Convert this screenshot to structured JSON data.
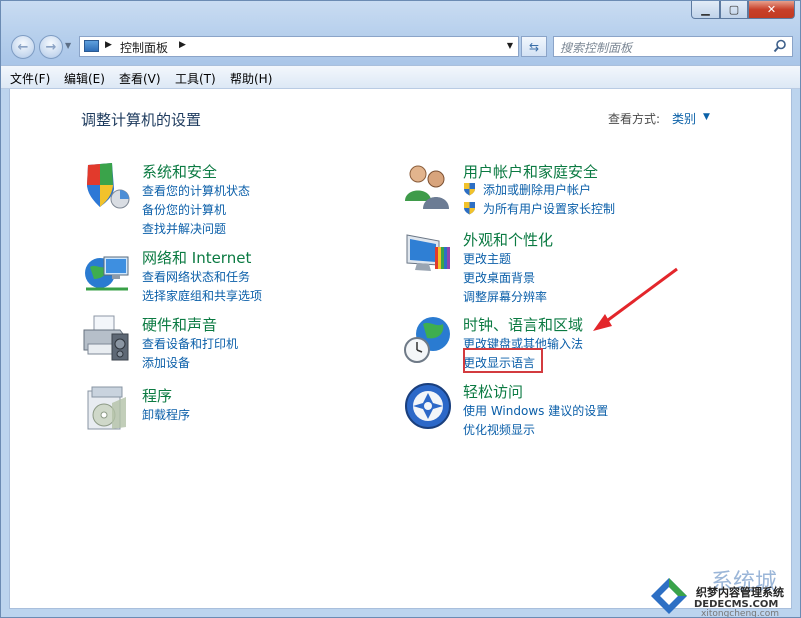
{
  "window": {
    "address": {
      "text": "控制面板"
    },
    "search": {
      "placeholder": "搜索控制面板"
    }
  },
  "menubar": {
    "items": [
      {
        "label": "文件(F)"
      },
      {
        "label": "编辑(E)"
      },
      {
        "label": "查看(V)"
      },
      {
        "label": "工具(T)"
      },
      {
        "label": "帮助(H)"
      }
    ]
  },
  "main": {
    "title": "调整计算机的设置",
    "view_label": "查看方式:",
    "view_value": "类别",
    "categories": [
      {
        "title": "系统和安全",
        "icon": "shield-icon",
        "links": [
          "查看您的计算机状态",
          "备份您的计算机",
          "查找并解决问题"
        ]
      },
      {
        "title": "网络和 Internet",
        "icon": "network-icon",
        "links": [
          "查看网络状态和任务",
          "选择家庭组和共享选项"
        ]
      },
      {
        "title": "硬件和声音",
        "icon": "printer-icon",
        "links": [
          "查看设备和打印机",
          "添加设备"
        ]
      },
      {
        "title": "程序",
        "icon": "programs-icon",
        "links": [
          "卸载程序"
        ]
      },
      {
        "title": "用户帐户和家庭安全",
        "icon": "users-icon",
        "links": [
          "添加或删除用户帐户",
          "为所有用户设置家长控制"
        ]
      },
      {
        "title": "外观和个性化",
        "icon": "display-icon",
        "links": [
          "更改主题",
          "更改桌面背景",
          "调整屏幕分辨率"
        ]
      },
      {
        "title": "时钟、语言和区域",
        "icon": "globe-clock-icon",
        "links": [
          "更改键盘或其他输入法",
          "更改显示语言"
        ]
      },
      {
        "title": "轻松访问",
        "icon": "ease-of-access-icon",
        "links": [
          "使用 Windows 建议的设置",
          "优化视频显示"
        ]
      }
    ]
  },
  "watermark": {
    "logo": "系统城",
    "line1": "织梦内容管理系统",
    "line2": "DEDECMS.COM",
    "line3": "xitongcheng.com"
  },
  "colors": {
    "accent": "#0b5fa9",
    "category_title": "#0b7a42",
    "annotation": "#d33b3f"
  }
}
